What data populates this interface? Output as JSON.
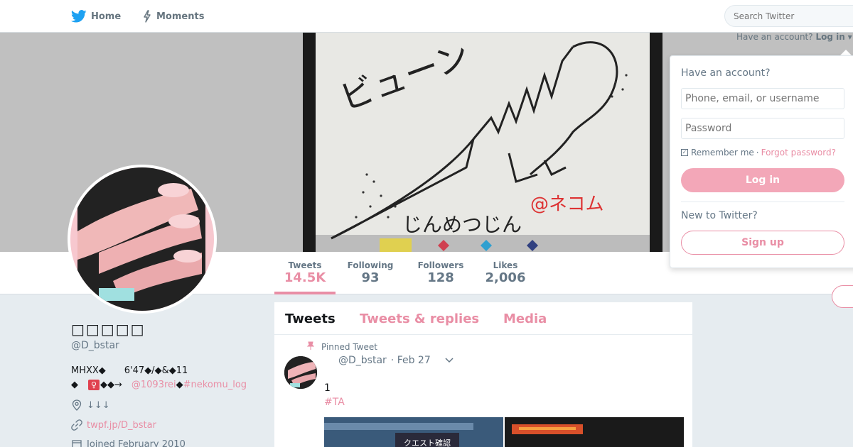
{
  "nav": {
    "home_label": "Home",
    "moments_label": "Moments",
    "search_placeholder": "Search Twitter"
  },
  "login_link": {
    "prompt": "Have an account?",
    "action": "Log in"
  },
  "login_dropdown": {
    "title": "Have an account?",
    "username_placeholder": "Phone, email, or username",
    "password_placeholder": "Password",
    "remember_label": "Remember me",
    "separator": "·",
    "forgot_label": "Forgot password?",
    "login_button": "Log in",
    "new_prompt": "New to Twitter?",
    "signup_button": "Sign up"
  },
  "stats": [
    {
      "label": "Tweets",
      "value": "14.5K"
    },
    {
      "label": "Following",
      "value": "93"
    },
    {
      "label": "Followers",
      "value": "128"
    },
    {
      "label": "Likes",
      "value": "2,006"
    }
  ],
  "profile": {
    "name": "□□□□□",
    "handle": "@D_bstar",
    "bio_line1": "MHXX◆　　6'47◆/◆&◆11",
    "bio_line2_a": "◆　",
    "bio_line2_venus": "♀",
    "bio_line2_b": "◆◆→　",
    "bio_mention": "@1093rei",
    "bio_line2_c": "◆",
    "bio_hashtag": "#nekomu_log",
    "location": "↓↓↓",
    "url": "twpf.jp/D_bstar",
    "joined": "Joined February 2010"
  },
  "banner_art": {
    "text1": "ビューン",
    "text2": "じんめつじん",
    "signature": "@ネコム"
  },
  "timeline": {
    "tabs": [
      "Tweets",
      "Tweets & replies",
      "Media"
    ],
    "pinned_label": "Pinned Tweet",
    "tweet_handle": "@D_bstar",
    "tweet_date": "· Feb 27",
    "tweet_text": "1",
    "tweet_hashtag": "#TA",
    "media_caption": "クエスト確認"
  },
  "colors": {
    "accent": "#e98ea5",
    "login_button": "#f3a7b8"
  }
}
